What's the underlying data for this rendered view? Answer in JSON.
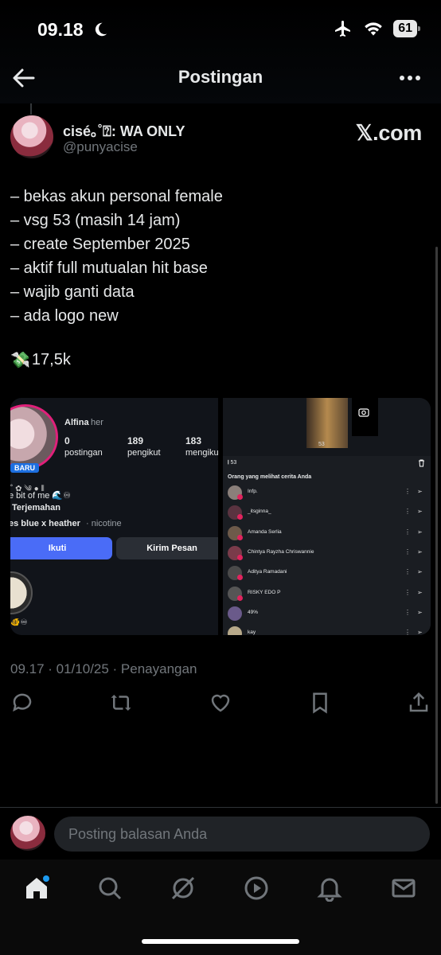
{
  "status_bar": {
    "time": "09.18",
    "battery": "61"
  },
  "header": {
    "title": "Postingan"
  },
  "post": {
    "display_name": "cisé｡˚⍰: WA ONLY",
    "handle": "@punyacise",
    "source_label": "𝕏.com",
    "lines": [
      "– bekas akun personal female",
      "– vsg 53 (masih 14 jam)",
      "– create September 2025",
      "– aktif full mutualan hit base",
      "– wajib ganti data",
      "– ada logo new"
    ],
    "price_emoji": "💸",
    "price": "17,5k",
    "timestamp": "09.17 · 01/10/25 · Penayangan"
  },
  "media_left": {
    "name": "Alfina",
    "pronoun": "her",
    "stats": [
      {
        "value": "0",
        "label": "postingan"
      },
      {
        "value": "189",
        "label": "pengikut"
      },
      {
        "value": "183",
        "label": "mengiku"
      }
    ],
    "badge": "BARU",
    "bio_line1": "e bit of me 🌊♾",
    "translate": "Terjemahan",
    "music_song": "es blue x heather",
    "music_artist": "· nicotine",
    "follow_label": "Ikuti",
    "message_label": "Kirim Pesan"
  },
  "media_right": {
    "views_top": "53",
    "count_label": "53",
    "section_title": "Orang yang melihat cerita Anda",
    "viewers": [
      "Infp.",
      "_itsginna_",
      "Amanda Serlia",
      "Chintya Rayzha Chriswannie",
      "Aditya Ramadani",
      "RISKY EDO P",
      "49%",
      "kay"
    ]
  },
  "reply": {
    "placeholder": "Posting balasan Anda"
  },
  "colors": {
    "background": "#000000",
    "text": "#e7e9ea",
    "muted": "#71767b",
    "accent": "#4a6cf7",
    "notify_dot": "#1d9bf0"
  }
}
